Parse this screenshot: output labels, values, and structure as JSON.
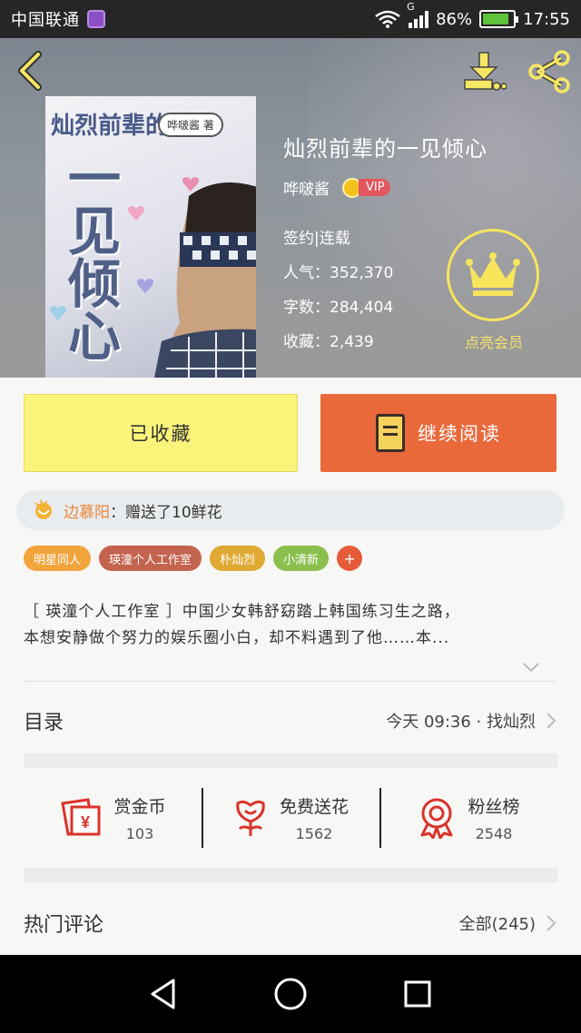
{
  "status_bar": {
    "carrier": "中国联通",
    "network": "G",
    "battery": "86%",
    "battery_level": 0.86,
    "time": "17:55"
  },
  "book": {
    "title": "灿烈前辈的一见倾心",
    "author": "哗啵酱",
    "vip_label": "VIP",
    "status": "签约|连载",
    "popularity": "人气：352,370",
    "word_count": "字数：284,404",
    "favorites": "收藏：2,439"
  },
  "cover": {
    "title_text": "灿烈前辈的",
    "vertical_text": "一见倾心",
    "author_tag": "哗啵酱 著"
  },
  "member": {
    "label": "点亮会员"
  },
  "actions": {
    "collected_label": "已收藏",
    "continue_label": "继续阅读"
  },
  "gift_banner": {
    "sender": "边慕阳",
    "message": "：赠送了10鲜花"
  },
  "tags": [
    {
      "label": "明星同人",
      "color": "#f2a43c"
    },
    {
      "label": "瑛潼个人工作室",
      "color": "#c4634e"
    },
    {
      "label": "朴灿烈",
      "color": "#e0a934"
    },
    {
      "label": "小清新",
      "color": "#8bbf4e"
    }
  ],
  "tag_add_label": "+",
  "synopsis": {
    "line1": "［ 瑛潼个人工作室 ］中国少女韩舒窈踏上韩国练习生之路，",
    "line2": "本想安静做个努力的娱乐圈小白，却不料遇到了他……本..."
  },
  "catalog": {
    "label": "目录",
    "latest": "今天 09:36 · 找灿烈"
  },
  "stats": [
    {
      "label": "赏金币",
      "value": "103",
      "icon": "red-envelope-icon"
    },
    {
      "label": "免费送花",
      "value": "1562",
      "icon": "flower-icon"
    },
    {
      "label": "粉丝榜",
      "value": "2548",
      "icon": "medal-icon"
    }
  ],
  "comments": {
    "label": "热门评论",
    "all": "全部(245)"
  },
  "colors": {
    "accent_orange": "#e9693b",
    "collected_yellow": "#fbf47b",
    "member_gold": "#f7e55c",
    "stat_icon_red": "#d9342b"
  }
}
